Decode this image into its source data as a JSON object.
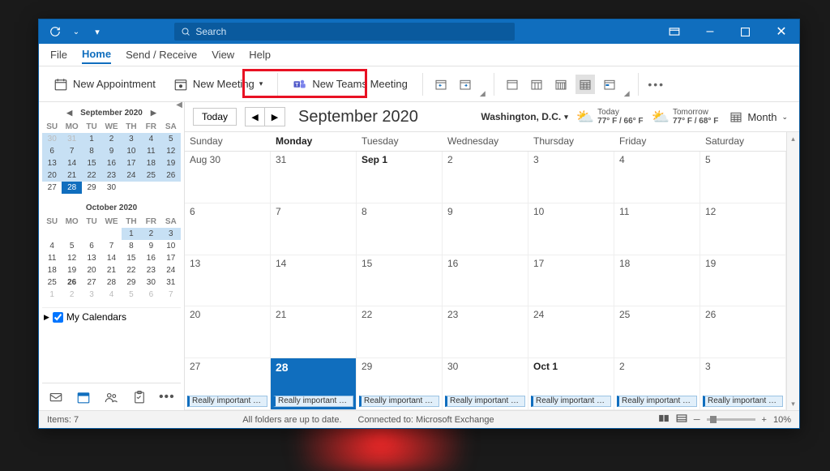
{
  "titlebar": {
    "search_placeholder": "Search",
    "minimize": "–",
    "maximize": "▢",
    "close": "✕"
  },
  "menu": {
    "file": "File",
    "home": "Home",
    "sendreceive": "Send / Receive",
    "view": "View",
    "help": "Help"
  },
  "ribbon": {
    "new_appointment": "New Appointment",
    "new_meeting": "New Meeting",
    "new_teams_meeting": "New Teams Meeting"
  },
  "sidebar": {
    "sep_title": "September 2020",
    "oct_title": "October 2020",
    "dow": [
      "SU",
      "MO",
      "TU",
      "WE",
      "TH",
      "FR",
      "SA"
    ],
    "sep_days": [
      [
        "dim range",
        "30"
      ],
      [
        "dim range",
        "31"
      ],
      [
        "range",
        "1"
      ],
      [
        "range",
        "2"
      ],
      [
        "range",
        "3"
      ],
      [
        "range",
        "4"
      ],
      [
        "range",
        "5"
      ],
      [
        "range",
        "6"
      ],
      [
        "range",
        "7"
      ],
      [
        "range",
        "8"
      ],
      [
        "range",
        "9"
      ],
      [
        "range",
        "10"
      ],
      [
        "range",
        "11"
      ],
      [
        "range",
        "12"
      ],
      [
        "range",
        "13"
      ],
      [
        "range",
        "14"
      ],
      [
        "range",
        "15"
      ],
      [
        "range",
        "16"
      ],
      [
        "range",
        "17"
      ],
      [
        "range",
        "18"
      ],
      [
        "range",
        "19"
      ],
      [
        "range",
        "20"
      ],
      [
        "range",
        "21"
      ],
      [
        "range",
        "22"
      ],
      [
        "range",
        "23"
      ],
      [
        "range",
        "24"
      ],
      [
        "range",
        "25"
      ],
      [
        "range",
        "26"
      ],
      [
        "",
        "27"
      ],
      [
        "sel",
        "28"
      ],
      [
        "",
        "29"
      ],
      [
        "",
        "30"
      ],
      [
        "",
        ""
      ],
      [
        "",
        ""
      ],
      [
        "",
        ""
      ]
    ],
    "oct_days": [
      [
        "",
        ""
      ],
      [
        "",
        ""
      ],
      [
        "",
        ""
      ],
      [
        "",
        ""
      ],
      [
        "range",
        "1"
      ],
      [
        "range",
        "2"
      ],
      [
        "range",
        "3"
      ],
      [
        "",
        "4"
      ],
      [
        "",
        "5"
      ],
      [
        "",
        "6"
      ],
      [
        "",
        "7"
      ],
      [
        "",
        "8"
      ],
      [
        "",
        "9"
      ],
      [
        "",
        "10"
      ],
      [
        "",
        "11"
      ],
      [
        "",
        "12"
      ],
      [
        "",
        "13"
      ],
      [
        "",
        "14"
      ],
      [
        "",
        "15"
      ],
      [
        "",
        "16"
      ],
      [
        "",
        "17"
      ],
      [
        "",
        "18"
      ],
      [
        "",
        "19"
      ],
      [
        "",
        "20"
      ],
      [
        "",
        "21"
      ],
      [
        "",
        "22"
      ],
      [
        "",
        "23"
      ],
      [
        "",
        "24"
      ],
      [
        "",
        "25"
      ],
      [
        "bold",
        "26"
      ],
      [
        "",
        "27"
      ],
      [
        "",
        "28"
      ],
      [
        "",
        "29"
      ],
      [
        "",
        "30"
      ],
      [
        "",
        "31"
      ],
      [
        "dim",
        "1"
      ],
      [
        "dim",
        "2"
      ],
      [
        "dim",
        "3"
      ],
      [
        "dim",
        "4"
      ],
      [
        "dim",
        "5"
      ],
      [
        "dim",
        "6"
      ],
      [
        "dim",
        "7"
      ]
    ],
    "my_calendars": "My Calendars"
  },
  "calendar": {
    "today_btn": "Today",
    "title": "September 2020",
    "location": "Washington,  D.C.",
    "today_label": "Today",
    "today_temp": "77° F / 66° F",
    "tomorrow_label": "Tomorrow",
    "tomorrow_temp": "77° F / 68° F",
    "view_label": "Month",
    "dow": [
      "Sunday",
      "Monday",
      "Tuesday",
      "Wednesday",
      "Thursday",
      "Friday",
      "Saturday"
    ],
    "cells": [
      [
        "Aug 30",
        ""
      ],
      [
        "31",
        ""
      ],
      [
        "Sep 1",
        "bold"
      ],
      [
        "2",
        ""
      ],
      [
        "3",
        ""
      ],
      [
        "4",
        ""
      ],
      [
        "5",
        ""
      ],
      [
        "6",
        ""
      ],
      [
        "7",
        ""
      ],
      [
        "8",
        ""
      ],
      [
        "9",
        ""
      ],
      [
        "10",
        ""
      ],
      [
        "11",
        ""
      ],
      [
        "12",
        ""
      ],
      [
        "13",
        ""
      ],
      [
        "14",
        ""
      ],
      [
        "15",
        ""
      ],
      [
        "16",
        ""
      ],
      [
        "17",
        ""
      ],
      [
        "18",
        ""
      ],
      [
        "19",
        ""
      ],
      [
        "20",
        ""
      ],
      [
        "21",
        ""
      ],
      [
        "22",
        ""
      ],
      [
        "23",
        ""
      ],
      [
        "24",
        ""
      ],
      [
        "25",
        ""
      ],
      [
        "26",
        ""
      ],
      [
        "27",
        "evt"
      ],
      [
        "28",
        "evt sel bold"
      ],
      [
        "29",
        "evt"
      ],
      [
        "30",
        "evt"
      ],
      [
        "Oct 1",
        "evt bold"
      ],
      [
        "2",
        "evt"
      ],
      [
        "3",
        "evt"
      ]
    ],
    "event_label": "Really important m..."
  },
  "status": {
    "items": "Items: 7",
    "folders": "All folders are up to date.",
    "connected": "Connected to: Microsoft Exchange",
    "zoom": "10%"
  }
}
